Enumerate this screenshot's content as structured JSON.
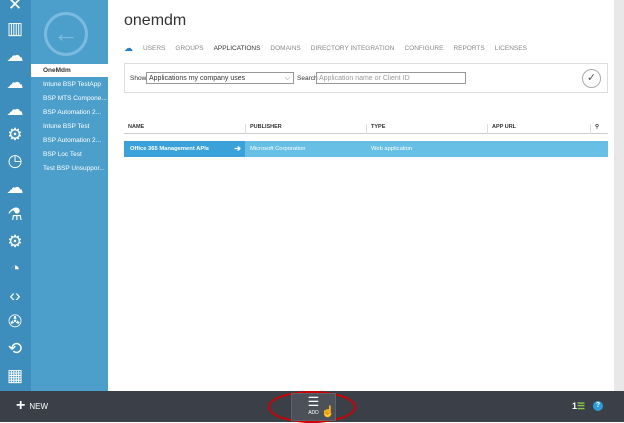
{
  "left_icons": [
    "tools-icon",
    "database-icon",
    "cloud-network-icon",
    "cloud-refresh-icon",
    "cloud-bolt-icon",
    "gear-bolt-icon",
    "clock-icon",
    "cloud-sync-icon",
    "flask-icon",
    "gear-network-icon",
    "chart-icon",
    "code-icon",
    "wrench-icon",
    "sync-icon",
    "storage-icon"
  ],
  "subnav": {
    "items": [
      "OneMdm",
      "Intune BSP TestApp",
      "BSP MTS Compone...",
      "BSP Automation 2...",
      "Intune BSP Test",
      "BSP Automation 2...",
      "BSP Loc Test",
      "Test BSP Unsuppor..."
    ],
    "active": 0
  },
  "main": {
    "title": "onemdm",
    "tabs": [
      "USERS",
      "GROUPS",
      "APPLICATIONS",
      "DOMAINS",
      "DIRECTORY INTEGRATION",
      "CONFIGURE",
      "REPORTS",
      "LICENSES"
    ],
    "active_tab": "APPLICATIONS",
    "filter": {
      "show_label": "Show",
      "show_value": "Applications my company uses",
      "search_label": "Search",
      "search_placeholder": "Application name or Client ID"
    },
    "table": {
      "headers": [
        "NAME",
        "PUBLISHER",
        "TYPE",
        "APP URL"
      ],
      "rows": [
        {
          "name": "Office 365 Management APIs",
          "publisher": "Microsoft Corporation",
          "type": "Web application",
          "url": ""
        }
      ]
    }
  },
  "bottom": {
    "new_label": "NEW",
    "add_label": "ADD",
    "count": "1"
  },
  "colors": {
    "accent": "#3aa2d8",
    "iconbar": "#3d8dbd",
    "bottom": "#3b4048"
  }
}
